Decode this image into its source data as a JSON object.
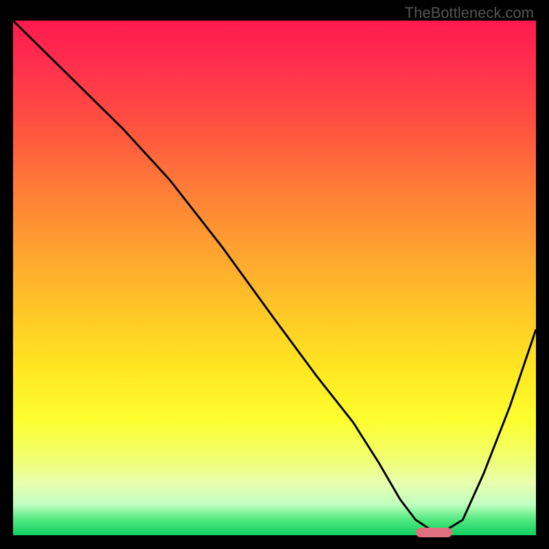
{
  "watermark": "TheBottleneck.com",
  "chart_data": {
    "type": "line",
    "title": "",
    "xlabel": "",
    "ylabel": "",
    "xlim": [
      0,
      100
    ],
    "ylim": [
      0,
      100
    ],
    "series": [
      {
        "name": "bottleneck-curve",
        "x": [
          0,
          12,
          21,
          30,
          40,
          50,
          58,
          65,
          70,
          74,
          77,
          80,
          82,
          86,
          90,
          95,
          100
        ],
        "values": [
          100,
          88,
          79,
          69,
          56,
          42,
          31,
          22,
          14,
          7,
          3,
          1,
          0.5,
          3,
          12,
          25,
          40
        ]
      }
    ],
    "optimal_marker": {
      "x_start": 77,
      "x_end": 84,
      "y": 0.5
    },
    "gradient": {
      "top_color": "#ff1a4d",
      "mid_color": "#ffe820",
      "bottom_color": "#10d060"
    }
  }
}
